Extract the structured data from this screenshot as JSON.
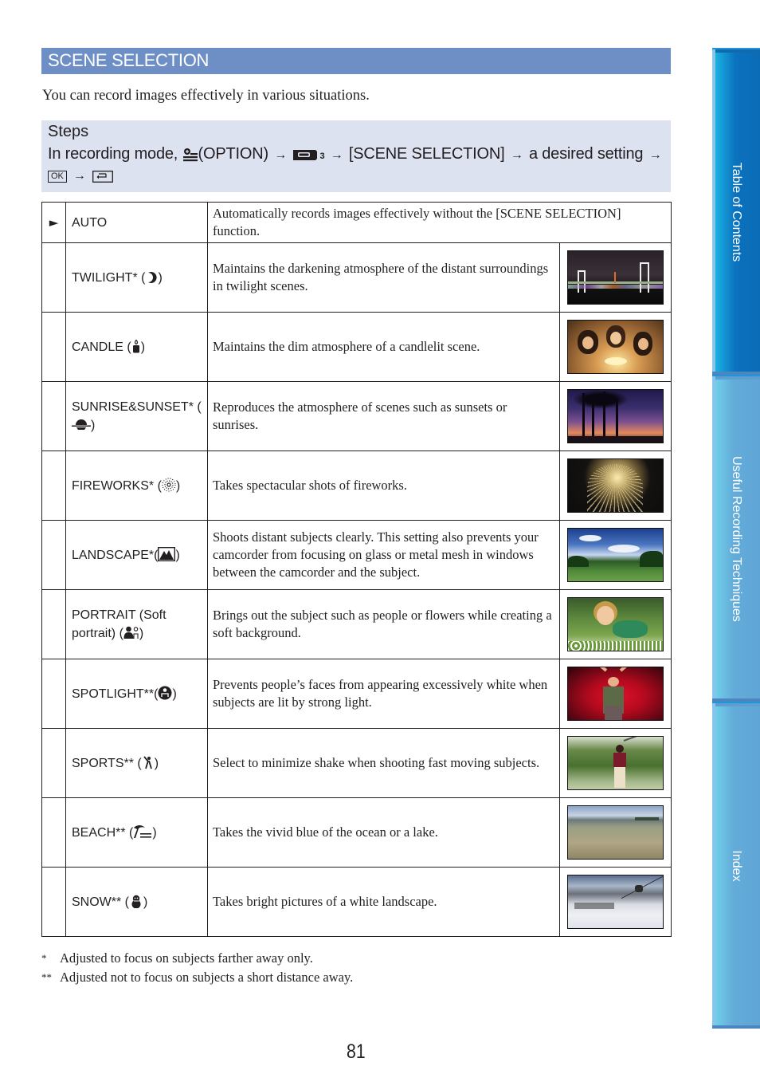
{
  "header": {
    "title": "SCENE SELECTION"
  },
  "intro": "You can record images effectively in various situations.",
  "steps": {
    "label": "Steps",
    "prefix": "In recording mode,",
    "option": "(OPTION)",
    "arrow": "→",
    "camera_sub": "3",
    "menu_item": "[SCENE SELECTION]",
    "desired": "a desired setting",
    "ok_button": "OK",
    "return_icon": "return-icon"
  },
  "table": {
    "default_marker": "►",
    "rows": [
      {
        "name": "AUTO",
        "icon": null,
        "description": "Automatically records images effectively without the [SCENE SELECTION] function.",
        "default": true,
        "thumb": null
      },
      {
        "name": "TWILIGHT* (",
        "icon": "twilight-moon-icon",
        "suffix": ")",
        "description": "Maintains the darkening atmosphere of the distant surroundings in twilight scenes.",
        "thumb": "night-bridge-photo"
      },
      {
        "name": "CANDLE (",
        "icon": "candle-icon",
        "suffix": ")",
        "description": "Maintains the dim atmosphere of a candlelit scene.",
        "thumb": "candlelit-birthday-photo"
      },
      {
        "name": "SUNRISE&SUNSET* (",
        "icon": "sunset-icon",
        "suffix": ")",
        "description": "Reproduces the atmosphere of scenes such as sunsets or sunrises.",
        "thumb": "palm-sunset-photo"
      },
      {
        "name": "FIREWORKS* (",
        "icon": "fireworks-icon",
        "suffix": ")",
        "description": "Takes spectacular shots of fireworks.",
        "thumb": "fireworks-photo"
      },
      {
        "name": "LANDSCAPE*(",
        "icon": "landscape-mountain-icon",
        "suffix": ")",
        "description": "Shoots distant subjects clearly. This setting also prevents your camcorder from focusing on glass or metal mesh in windows between the camcorder and the subject.",
        "thumb": "field-sky-photo"
      },
      {
        "name": "PORTRAIT (Soft portrait) (",
        "icon": "portrait-icon",
        "suffix": ")",
        "description": "Brings out the subject such as people or flowers while creating a soft background.",
        "thumb": "boy-in-flowers-photo"
      },
      {
        "name": "SPOTLIGHT**(",
        "icon": "spotlight-icon",
        "suffix": ")",
        "description": "Prevents people’s faces from appearing excessively white when subjects are lit by strong light.",
        "thumb": "stage-spotlight-photo"
      },
      {
        "name": "SPORTS** (",
        "icon": "sports-golfer-icon",
        "suffix": ")",
        "description": "Select to minimize shake when shooting fast moving subjects.",
        "thumb": "golfer-photo"
      },
      {
        "name": "BEACH** (",
        "icon": "beach-palm-icon",
        "suffix": ")",
        "description": "Takes the vivid blue of the ocean or a lake.",
        "thumb": "shallow-sea-photo"
      },
      {
        "name": "SNOW** (",
        "icon": "snowman-icon",
        "suffix": ")",
        "description": "Takes bright pictures of a white landscape.",
        "thumb": "ski-slope-photo"
      }
    ]
  },
  "notes": [
    {
      "mark": "*",
      "text": "Adjusted to focus on subjects farther away only."
    },
    {
      "mark": "**",
      "text": "Adjusted not to focus on subjects a short distance away."
    }
  ],
  "page_number": "81",
  "side_tabs": [
    {
      "label": "Table of Contents"
    },
    {
      "label": "Useful Recording Techniques"
    },
    {
      "label": "Index"
    }
  ]
}
